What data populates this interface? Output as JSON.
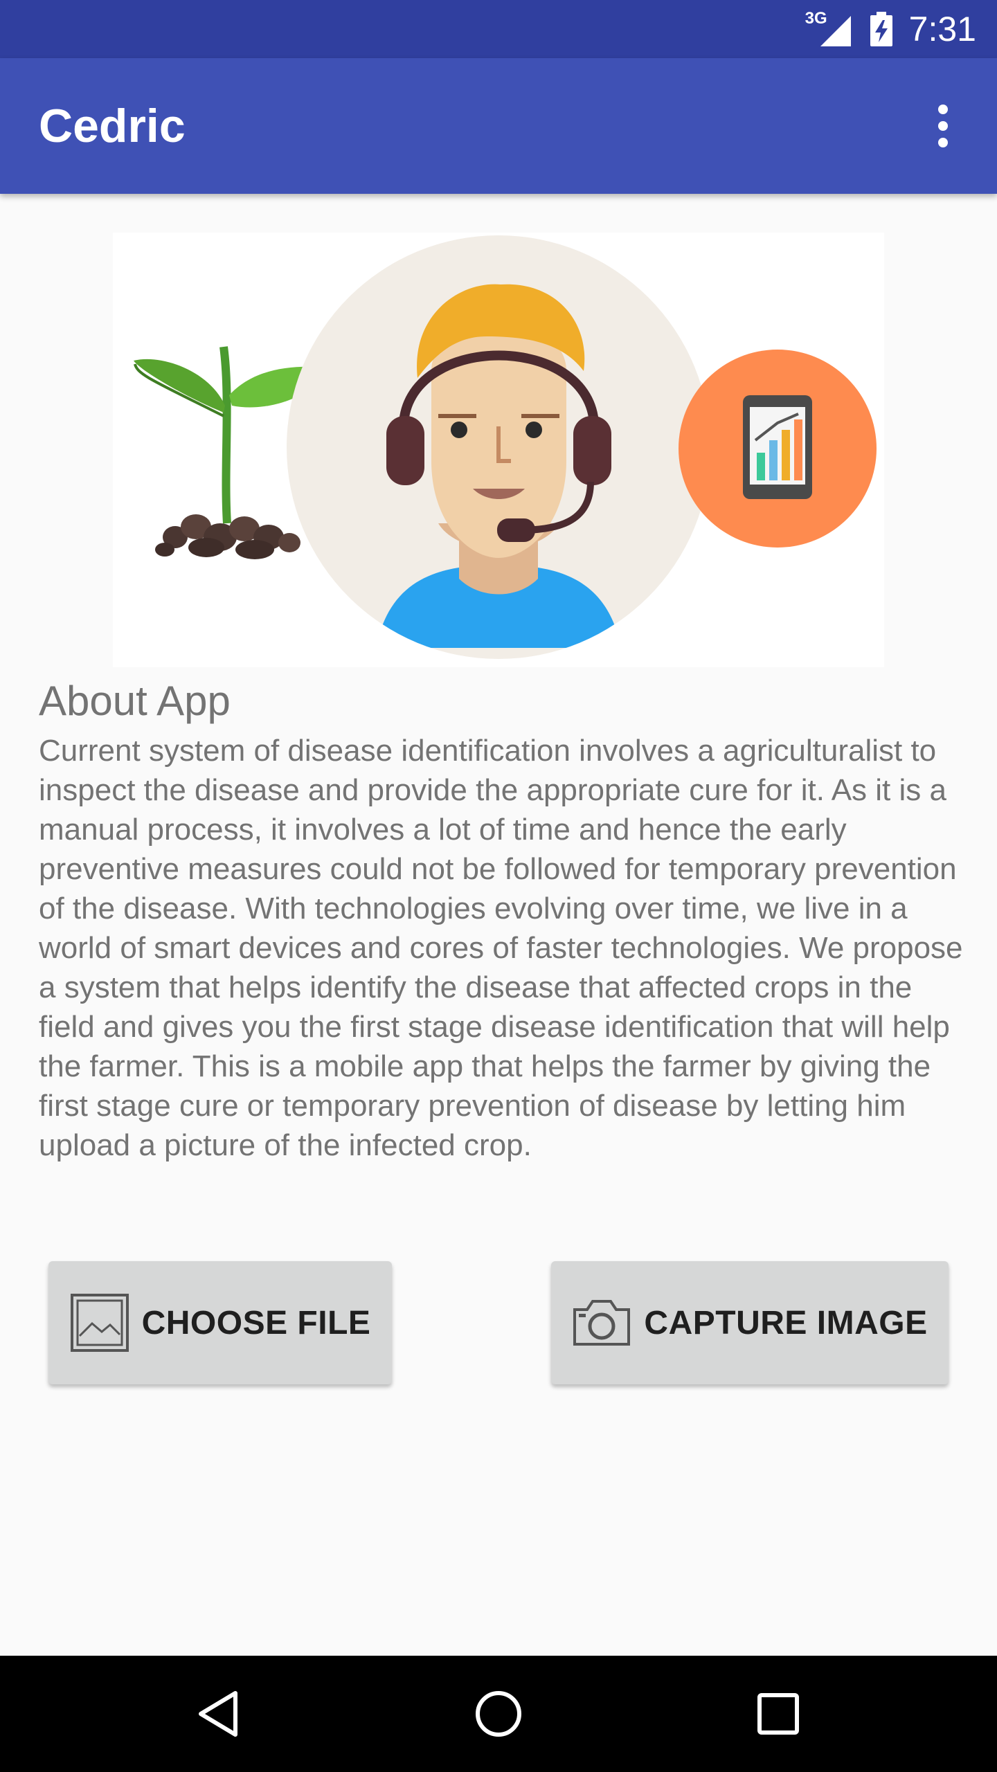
{
  "status_bar": {
    "network": "3G",
    "time": "7:31"
  },
  "app_bar": {
    "title": "Cedric",
    "overflow_icon": "more-vert-icon"
  },
  "hero": {
    "illustration": "plant-agent-analytics-illustration"
  },
  "about": {
    "title": "About App",
    "body": "Current system of disease identification involves a agriculturalist to inspect the disease and provide the appropriate cure for it. As it is a manual process, it involves a lot of time and hence the early preventive measures could not be followed for temporary prevention of the disease. With technologies evolving over time, we live in a world of smart devices and cores of faster technologies. We propose a system that helps identify the disease that affected crops in the field and gives you the first stage disease identification that will help the farmer. This is a mobile app that helps the farmer by giving the first stage cure or temporary prevention of disease by letting him upload a picture of the infected crop."
  },
  "actions": {
    "choose_file_label": "CHOOSE FILE",
    "capture_image_label": "CAPTURE IMAGE"
  },
  "colors": {
    "status_bar": "#303f9f",
    "app_bar": "#3f51b5",
    "button_bg": "#d6d7d7",
    "body_text": "#737373"
  }
}
